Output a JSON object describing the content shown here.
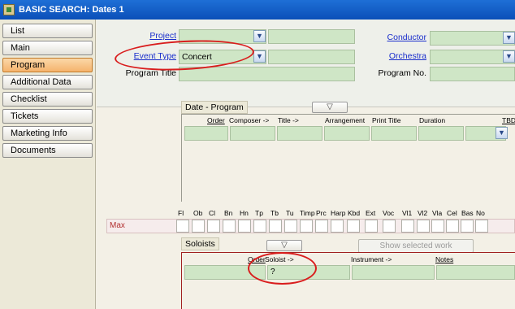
{
  "window": {
    "title": "BASIC SEARCH: Dates  1"
  },
  "sidebar": {
    "items": [
      {
        "label": "List"
      },
      {
        "label": "Main"
      },
      {
        "label": "Program"
      },
      {
        "label": "Additional Data"
      },
      {
        "label": "Checklist"
      },
      {
        "label": "Tickets"
      },
      {
        "label": "Marketing Info"
      },
      {
        "label": "Documents"
      }
    ]
  },
  "form": {
    "project_label": "Project",
    "event_type_label": "Event Type",
    "event_type_value": "Concert",
    "program_title_label": "Program Title",
    "conductor_label": "Conductor",
    "orchestra_label": "Orchestra",
    "program_no_label": "Program No."
  },
  "date_program": {
    "label": "Date - Program",
    "columns": [
      "Order",
      "Composer ->",
      "Title ->",
      "Arrangement",
      "Print Title",
      "Duration",
      "TBD"
    ]
  },
  "instruments": {
    "row_label": "Max",
    "names": [
      "Fl",
      "Ob",
      "Cl",
      "Bn",
      "Hn",
      "Tp",
      "Tb",
      "Tu",
      "Timp",
      "Prc",
      "Harp",
      "Kbd",
      "Ext",
      "Voc",
      "Vl1",
      "Vl2",
      "Vla",
      "Cel",
      "Bas",
      "No"
    ]
  },
  "soloists": {
    "label": "Soloists",
    "show_button": "Show selected work",
    "columns": [
      "Order",
      "Soloist ->",
      "Instrument ->",
      "Notes"
    ],
    "row_soloist": "?"
  },
  "colors": {
    "field_green": "#cfe6c6",
    "annotation_red": "#d91d1d",
    "active_tab": "#f5b36d"
  }
}
